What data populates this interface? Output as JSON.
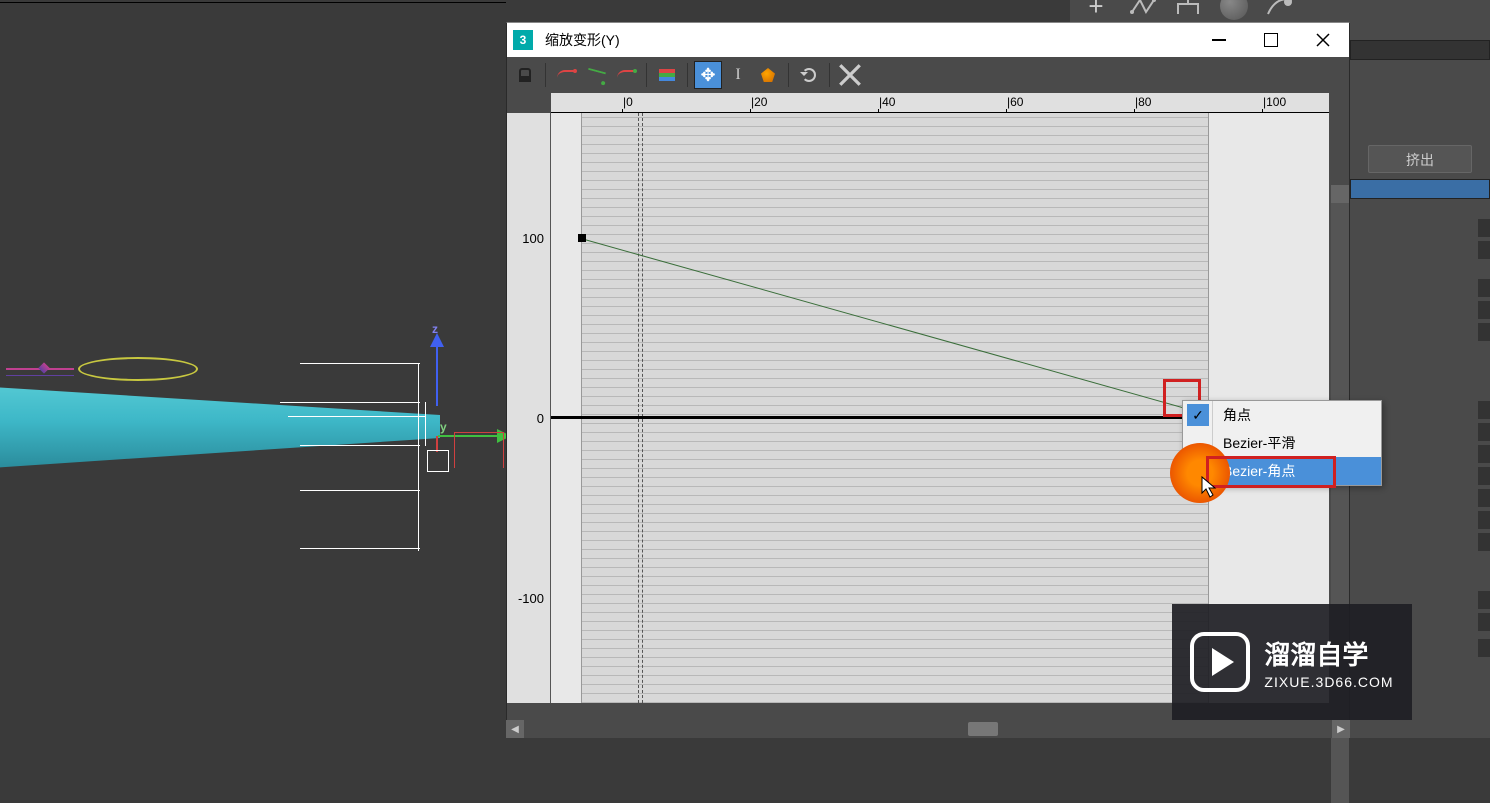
{
  "top_toolbar": {},
  "right_panel": {
    "button1": "挤出"
  },
  "dialog": {
    "icon_text": "3",
    "title": "缩放变形(Y)",
    "x_ticks": [
      {
        "label": "|0",
        "pos": 72
      },
      {
        "label": "|20",
        "pos": 200
      },
      {
        "label": "|40",
        "pos": 328
      },
      {
        "label": "|60",
        "pos": 456
      },
      {
        "label": "|80",
        "pos": 584
      },
      {
        "label": "|100",
        "pos": 712
      }
    ],
    "y_ticks": [
      {
        "label": "100",
        "pos": 118
      },
      {
        "label": "0",
        "pos": 298
      },
      {
        "label": "-100",
        "pos": 478
      }
    ]
  },
  "context_menu": {
    "item1": "角点",
    "item2": "Bezier-平滑",
    "item3": "Bezier-角点"
  },
  "watermark": {
    "line1": "溜溜自学",
    "line2": "ZIXUE.3D66.COM"
  },
  "gizmo": {
    "z": "z",
    "y": "y"
  },
  "chart_data": {
    "type": "line",
    "title": "缩放变形(Y)",
    "xlabel": "",
    "ylabel": "",
    "xlim": [
      0,
      100
    ],
    "ylim": [
      -100,
      100
    ],
    "x": [
      0,
      100
    ],
    "values": [
      100,
      0
    ],
    "points": [
      {
        "x": 0,
        "y": 100,
        "type": "corner"
      },
      {
        "x": 100,
        "y": 0,
        "type": "corner",
        "selected": true
      }
    ]
  }
}
